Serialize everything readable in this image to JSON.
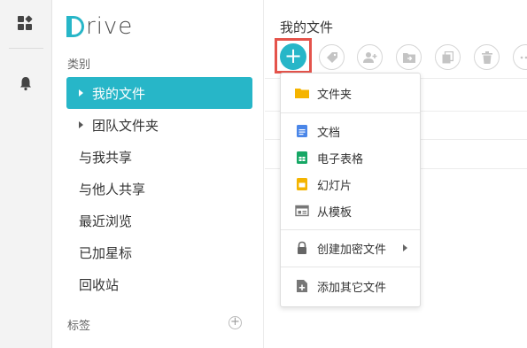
{
  "app": {
    "logo_text": "rive"
  },
  "sidebar": {
    "category_label": "类别",
    "items": [
      {
        "label": "我的文件",
        "active": true,
        "has_caret": true
      },
      {
        "label": "团队文件夹",
        "active": false,
        "has_caret": true
      },
      {
        "label": "与我共享",
        "active": false,
        "has_caret": false
      },
      {
        "label": "与他人共享",
        "active": false,
        "has_caret": false
      },
      {
        "label": "最近浏览",
        "active": false,
        "has_caret": false
      },
      {
        "label": "已加星标",
        "active": false,
        "has_caret": false
      },
      {
        "label": "回收站",
        "active": false,
        "has_caret": false
      }
    ],
    "tags_label": "标签",
    "tags_add": "+"
  },
  "main": {
    "title": "我的文件",
    "add_button": "+"
  },
  "menu": {
    "folder": "文件夹",
    "document": "文档",
    "spreadsheet": "电子表格",
    "slides": "幻灯片",
    "from_template": "从模板",
    "encrypted": "创建加密文件",
    "other": "添加其它文件"
  },
  "colors": {
    "accent": "#27b6c8",
    "highlight_frame": "#e4534b",
    "folder": "#f5b400",
    "doc": "#4a86e8",
    "sheet": "#16a765",
    "slides": "#f4b400"
  }
}
